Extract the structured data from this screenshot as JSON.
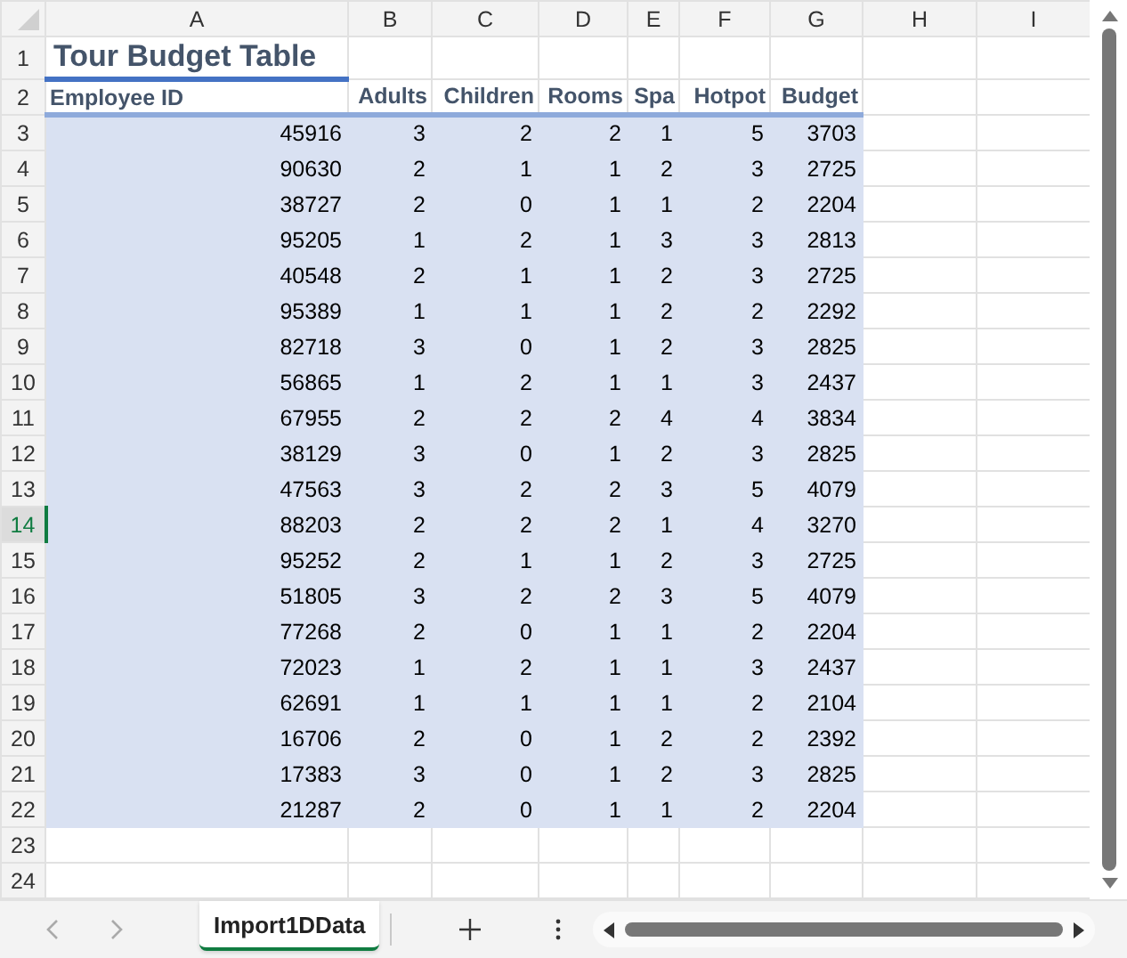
{
  "column_headers": [
    "A",
    "B",
    "C",
    "D",
    "E",
    "F",
    "G",
    "H",
    "I"
  ],
  "row_headers": [
    {
      "label": "1",
      "selected": false
    },
    {
      "label": "2",
      "selected": false
    },
    {
      "label": "3",
      "selected": false
    },
    {
      "label": "4",
      "selected": false
    },
    {
      "label": "5",
      "selected": false
    },
    {
      "label": "6",
      "selected": false
    },
    {
      "label": "7",
      "selected": false
    },
    {
      "label": "8",
      "selected": false
    },
    {
      "label": "9",
      "selected": false
    },
    {
      "label": "10",
      "selected": false
    },
    {
      "label": "11",
      "selected": false
    },
    {
      "label": "12",
      "selected": false
    },
    {
      "label": "13",
      "selected": false
    },
    {
      "label": "14",
      "selected": true
    },
    {
      "label": "15",
      "selected": false
    },
    {
      "label": "16",
      "selected": false
    },
    {
      "label": "17",
      "selected": false
    },
    {
      "label": "18",
      "selected": false
    },
    {
      "label": "19",
      "selected": false
    },
    {
      "label": "20",
      "selected": false
    },
    {
      "label": "21",
      "selected": false
    },
    {
      "label": "22",
      "selected": false
    },
    {
      "label": "23",
      "selected": false
    },
    {
      "label": "24",
      "selected": false
    }
  ],
  "title": "Tour Budget Table",
  "table": {
    "columns": [
      "Employee ID",
      "Adults",
      "Children",
      "Rooms",
      "Spa",
      "Hotpot",
      "Budget"
    ],
    "rows": [
      [
        "45916",
        "3",
        "2",
        "2",
        "1",
        "5",
        "3703"
      ],
      [
        "90630",
        "2",
        "1",
        "1",
        "2",
        "3",
        "2725"
      ],
      [
        "38727",
        "2",
        "0",
        "1",
        "1",
        "2",
        "2204"
      ],
      [
        "95205",
        "1",
        "2",
        "1",
        "3",
        "3",
        "2813"
      ],
      [
        "40548",
        "2",
        "1",
        "1",
        "2",
        "3",
        "2725"
      ],
      [
        "95389",
        "1",
        "1",
        "1",
        "2",
        "2",
        "2292"
      ],
      [
        "82718",
        "3",
        "0",
        "1",
        "2",
        "3",
        "2825"
      ],
      [
        "56865",
        "1",
        "2",
        "1",
        "1",
        "3",
        "2437"
      ],
      [
        "67955",
        "2",
        "2",
        "2",
        "4",
        "4",
        "3834"
      ],
      [
        "38129",
        "3",
        "0",
        "1",
        "2",
        "3",
        "2825"
      ],
      [
        "47563",
        "3",
        "2",
        "2",
        "3",
        "5",
        "4079"
      ],
      [
        "88203",
        "2",
        "2",
        "2",
        "1",
        "4",
        "3270"
      ],
      [
        "95252",
        "2",
        "1",
        "1",
        "2",
        "3",
        "2725"
      ],
      [
        "51805",
        "3",
        "2",
        "2",
        "3",
        "5",
        "4079"
      ],
      [
        "77268",
        "2",
        "0",
        "1",
        "1",
        "2",
        "2204"
      ],
      [
        "72023",
        "1",
        "2",
        "1",
        "1",
        "3",
        "2437"
      ],
      [
        "62691",
        "1",
        "1",
        "1",
        "1",
        "2",
        "2104"
      ],
      [
        "16706",
        "2",
        "0",
        "1",
        "2",
        "2",
        "2392"
      ],
      [
        "17383",
        "3",
        "0",
        "1",
        "2",
        "3",
        "2825"
      ],
      [
        "21287",
        "2",
        "0",
        "1",
        "1",
        "2",
        "2204"
      ]
    ]
  },
  "sheet_tabs": [
    {
      "label": "Import1DData",
      "selected": true
    }
  ]
}
